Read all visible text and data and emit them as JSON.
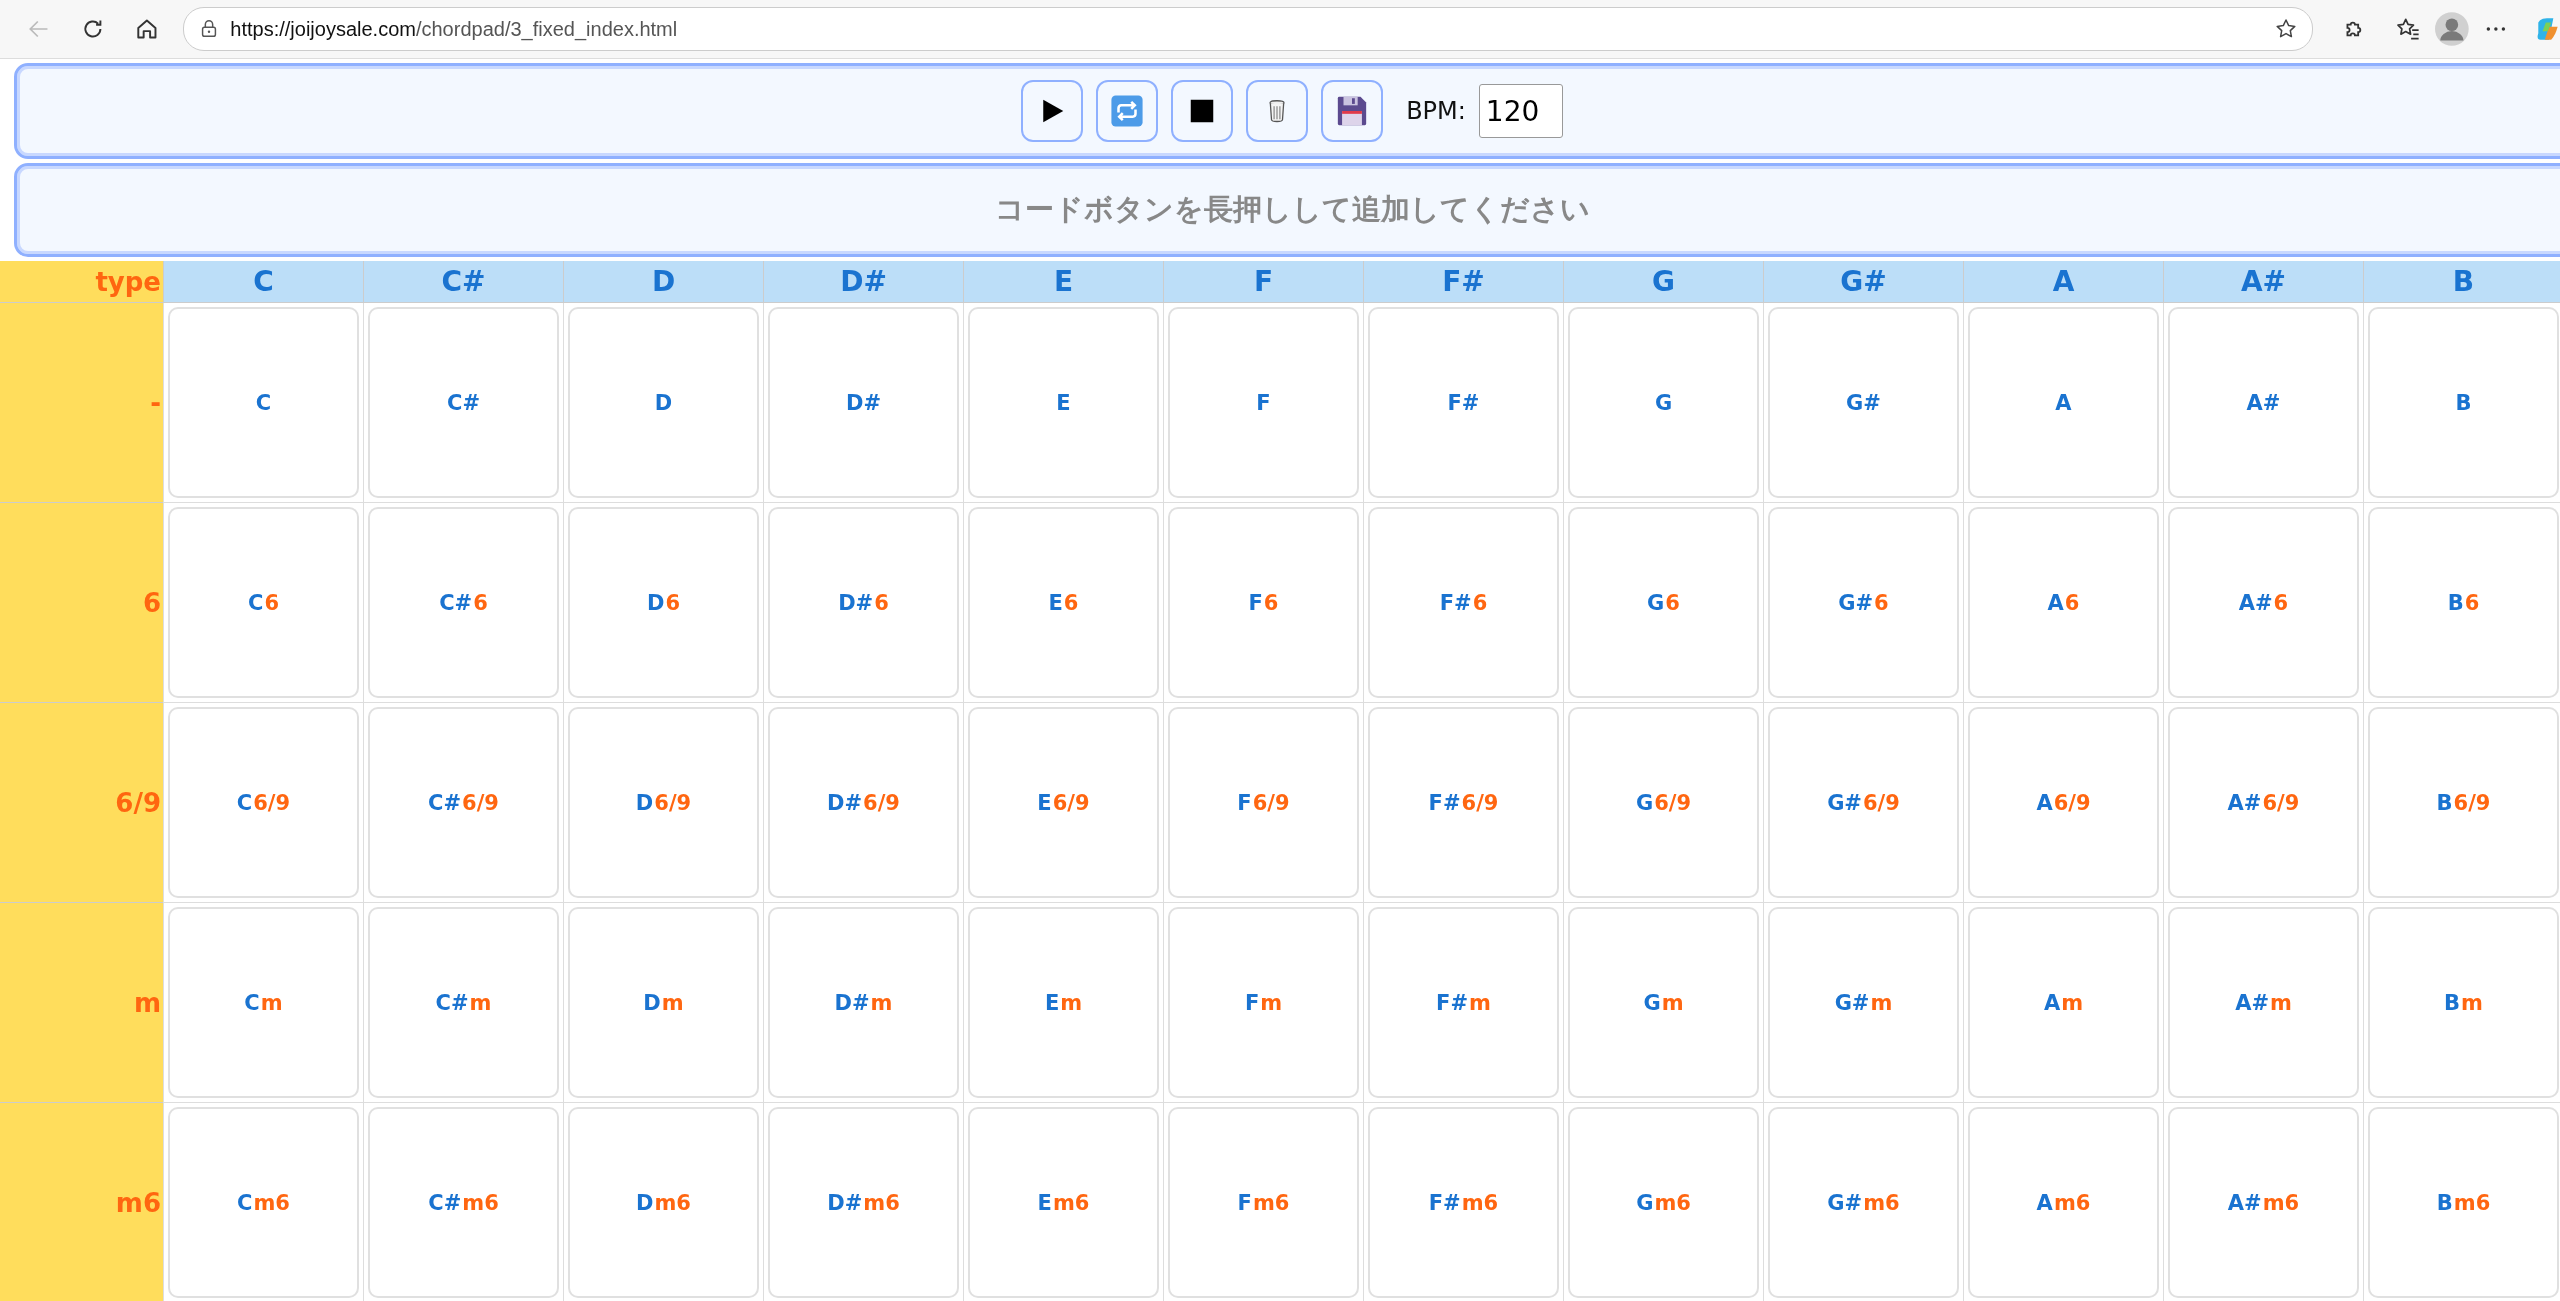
{
  "browser": {
    "url_host": "https://joijoysale.com",
    "url_path": "/chordpad/3_fixed_index.html",
    "back_disabled": true
  },
  "toolbar": {
    "buttons": [
      {
        "kind": "play"
      },
      {
        "kind": "loop"
      },
      {
        "kind": "stop"
      },
      {
        "kind": "trash"
      },
      {
        "kind": "save"
      }
    ],
    "bpm_label": "BPM:",
    "bpm_value": "120"
  },
  "message": "コードボタンを長押しして追加してください",
  "table": {
    "corner": "type",
    "columns": [
      "C",
      "C#",
      "D",
      "D#",
      "E",
      "F",
      "F#",
      "G",
      "G#",
      "A",
      "A#",
      "B"
    ],
    "rows": [
      {
        "type": "-",
        "cells": [
          {
            "root": "C"
          },
          {
            "root": "C#"
          },
          {
            "root": "D"
          },
          {
            "root": "D#"
          },
          {
            "root": "E"
          },
          {
            "root": "F"
          },
          {
            "root": "F#"
          },
          {
            "root": "G"
          },
          {
            "root": "G#"
          },
          {
            "root": "A"
          },
          {
            "root": "A#"
          },
          {
            "root": "B"
          }
        ]
      },
      {
        "type": "6",
        "cells": [
          {
            "root": "C",
            "suffix": "6"
          },
          {
            "root": "C#",
            "suffix": "6"
          },
          {
            "root": "D",
            "suffix": "6"
          },
          {
            "root": "D#",
            "suffix": "6"
          },
          {
            "root": "E",
            "suffix": "6"
          },
          {
            "root": "F",
            "suffix": "6"
          },
          {
            "root": "F#",
            "suffix": "6"
          },
          {
            "root": "G",
            "suffix": "6"
          },
          {
            "root": "G#",
            "suffix": "6"
          },
          {
            "root": "A",
            "suffix": "6"
          },
          {
            "root": "A#",
            "suffix": "6"
          },
          {
            "root": "B",
            "suffix": "6"
          }
        ]
      },
      {
        "type": "6/9",
        "cells": [
          {
            "root": "C",
            "suffix": "6/9"
          },
          {
            "root": "C#",
            "suffix": "6/9"
          },
          {
            "root": "D",
            "suffix": "6/9"
          },
          {
            "root": "D#",
            "suffix": "6/9"
          },
          {
            "root": "E",
            "suffix": "6/9"
          },
          {
            "root": "F",
            "suffix": "6/9"
          },
          {
            "root": "F#",
            "suffix": "6/9"
          },
          {
            "root": "G",
            "suffix": "6/9"
          },
          {
            "root": "G#",
            "suffix": "6/9"
          },
          {
            "root": "A",
            "suffix": "6/9"
          },
          {
            "root": "A#",
            "suffix": "6/9"
          },
          {
            "root": "B",
            "suffix": "6/9"
          }
        ]
      },
      {
        "type": "m",
        "cells": [
          {
            "root": "C",
            "suffix": "m"
          },
          {
            "root": "C#",
            "suffix": "m"
          },
          {
            "root": "D",
            "suffix": "m"
          },
          {
            "root": "D#",
            "suffix": "m"
          },
          {
            "root": "E",
            "suffix": "m"
          },
          {
            "root": "F",
            "suffix": "m"
          },
          {
            "root": "F#",
            "suffix": "m"
          },
          {
            "root": "G",
            "suffix": "m"
          },
          {
            "root": "G#",
            "suffix": "m"
          },
          {
            "root": "A",
            "suffix": "m"
          },
          {
            "root": "A#",
            "suffix": "m"
          },
          {
            "root": "B",
            "suffix": "m"
          }
        ]
      },
      {
        "type": "m6",
        "cells": [
          {
            "root": "C",
            "suffix": "m6"
          },
          {
            "root": "C#",
            "suffix": "m6"
          },
          {
            "root": "D",
            "suffix": "m6"
          },
          {
            "root": "D#",
            "suffix": "m6"
          },
          {
            "root": "E",
            "suffix": "m6"
          },
          {
            "root": "F",
            "suffix": "m6"
          },
          {
            "root": "F#",
            "suffix": "m6"
          },
          {
            "root": "G",
            "suffix": "m6"
          },
          {
            "root": "G#",
            "suffix": "m6"
          },
          {
            "root": "A",
            "suffix": "m6"
          },
          {
            "root": "A#",
            "suffix": "m6"
          },
          {
            "root": "B",
            "suffix": "m6"
          }
        ]
      }
    ]
  }
}
